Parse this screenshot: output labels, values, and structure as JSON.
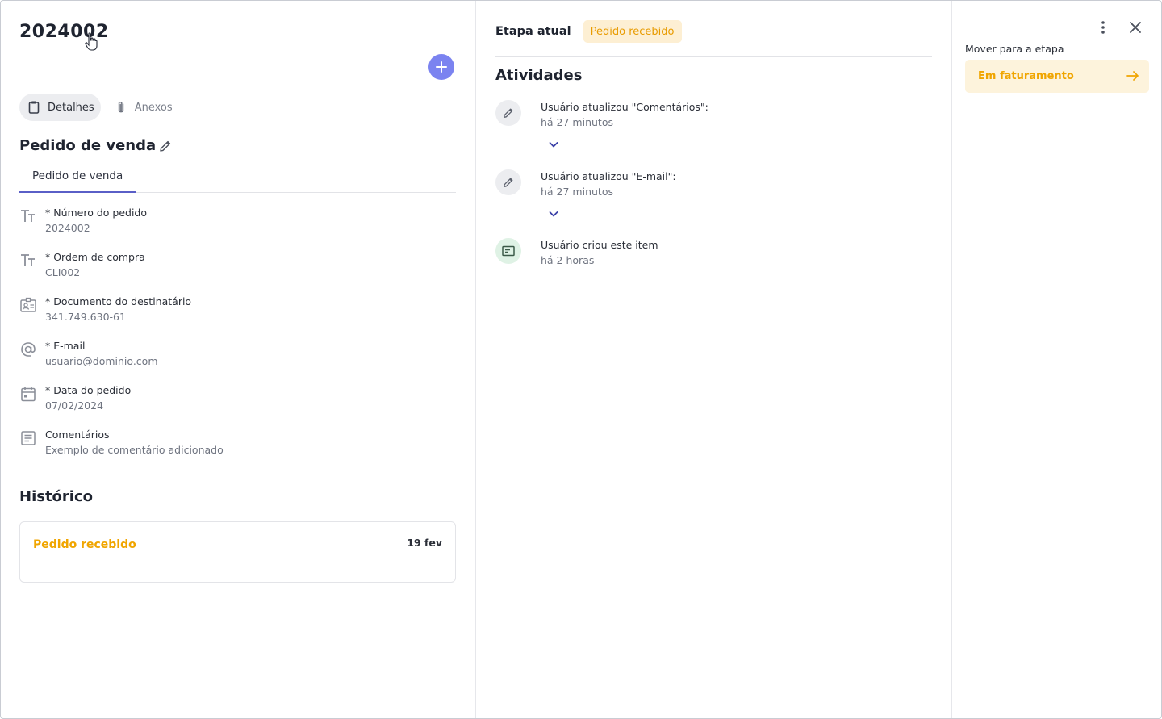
{
  "record": {
    "title": "2024002"
  },
  "tabs": [
    {
      "label": "Detalhes",
      "icon": "clipboard-icon",
      "active": true
    },
    {
      "label": "Anexos",
      "icon": "paperclip-icon",
      "active": false
    }
  ],
  "form": {
    "title": "Pedido de venda",
    "subtab": "Pedido de venda",
    "fields": [
      {
        "label": "* Número do pedido",
        "value": "2024002",
        "icon": "text-type-icon"
      },
      {
        "label": "* Ordem de compra",
        "value": "CLI002",
        "icon": "text-type-icon"
      },
      {
        "label": "* Documento do destinatário",
        "value": "341.749.630-61",
        "icon": "id-card-icon"
      },
      {
        "label": "* E-mail",
        "value": "usuario@dominio.com",
        "icon": "at-sign-icon"
      },
      {
        "label": "* Data do pedido",
        "value": "07/02/2024",
        "icon": "calendar-icon"
      },
      {
        "label": "Comentários",
        "value": "Exemplo de comentário adicionado",
        "icon": "notes-icon"
      }
    ]
  },
  "history": {
    "title": "Histórico",
    "entries": [
      {
        "stage": "Pedido recebido",
        "date": "19 fev"
      }
    ]
  },
  "stage": {
    "label": "Etapa atual",
    "current": "Pedido recebido"
  },
  "activities": {
    "title": "Atividades",
    "items": [
      {
        "text": "Usuário atualizou \"Comentários\":",
        "time": "há 27 minutos",
        "icon": "pencil-icon",
        "expandable": true
      },
      {
        "text": "Usuário atualizou \"E-mail\":",
        "time": "há 27 minutos",
        "icon": "pencil-icon",
        "expandable": true
      },
      {
        "text": "Usuário criou este item",
        "time": "há 2 horas",
        "icon": "card-icon",
        "expandable": false
      }
    ]
  },
  "move": {
    "label": "Mover para a etapa",
    "target": "Em faturamento"
  },
  "colors": {
    "accent": "#7b83f0",
    "tab_underline": "#5a5fc7",
    "stage_orange": "#f0a500",
    "stage_badge_bg": "#fdefd3",
    "move_bg": "#fdf3dc",
    "created_bg": "#dff2e5"
  }
}
